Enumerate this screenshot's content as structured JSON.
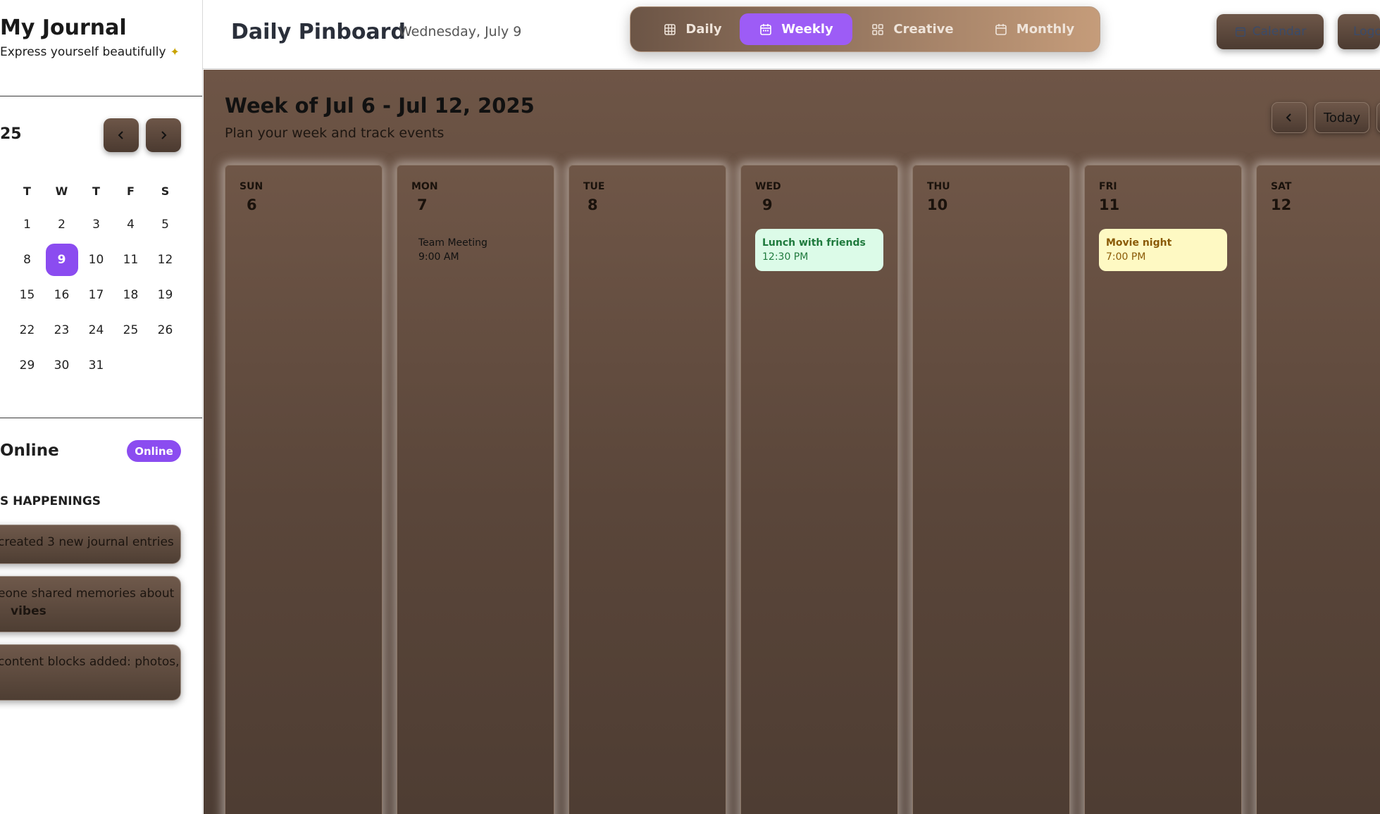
{
  "sidebar": {
    "title": "My Journal",
    "subtitle": "Express yourself beautifully",
    "calendar": {
      "title": "25",
      "weekdays": [
        "T",
        "W",
        "T",
        "F",
        "S"
      ],
      "weeks": [
        [
          "1",
          "2",
          "3",
          "4",
          "5"
        ],
        [
          "8",
          "9",
          "10",
          "11",
          "12"
        ],
        [
          "15",
          "16",
          "17",
          "18",
          "19"
        ],
        [
          "22",
          "23",
          "24",
          "25",
          "26"
        ],
        [
          "29",
          "30",
          "31",
          "",
          ""
        ]
      ],
      "selected_day": "9",
      "prev_icon": "chevron-left-icon",
      "next_icon": "chevron-right-icon"
    },
    "online": {
      "title": "Online",
      "badge": "Online"
    },
    "happenings": {
      "title": "S HAPPENINGS",
      "items": [
        {
          "text": "created 3 new journal entries",
          "bold": ""
        },
        {
          "text": "eone shared memories about",
          "bold": "vibes"
        },
        {
          "text": "content blocks added: photos,",
          "bold": ""
        }
      ]
    }
  },
  "header": {
    "title": "Daily Pinboard",
    "date": "Wednesday, July 9",
    "view_tabs": [
      {
        "label": "Daily",
        "icon": "grid-icon",
        "active": false
      },
      {
        "label": "Weekly",
        "icon": "calendar-icon",
        "active": true
      },
      {
        "label": "Creative",
        "icon": "layout-icon",
        "active": false
      },
      {
        "label": "Monthly",
        "icon": "calendar-icon",
        "active": false
      }
    ],
    "buttons": [
      {
        "label": "Calendar"
      },
      {
        "label": "Logo"
      }
    ]
  },
  "board": {
    "title": "Week of Jul 6 - Jul 12, 2025",
    "subtitle": "Plan your week and track events",
    "prev_icon": "chevron-left-icon",
    "today_label": "Today",
    "days": [
      {
        "name": "SUN",
        "num": "6",
        "event": null
      },
      {
        "name": "MON",
        "num": "7",
        "event": {
          "title": "Team Meeting",
          "time": "9:00 AM",
          "style": "plain"
        }
      },
      {
        "name": "TUE",
        "num": "8",
        "event": null
      },
      {
        "name": "WED",
        "num": "9",
        "event": {
          "title": "Lunch with friends",
          "time": "12:30 PM",
          "style": "green"
        }
      },
      {
        "name": "THU",
        "num": "10",
        "event": null
      },
      {
        "name": "FRI",
        "num": "11",
        "event": {
          "title": "Movie night",
          "time": "7:00 PM",
          "style": "yellow"
        }
      },
      {
        "name": "SAT",
        "num": "12",
        "event": null
      }
    ]
  },
  "colors": {
    "accent": "#8b4cf0",
    "board_brown": "#5e4a3e",
    "event_green_bg": "#dcfbe8",
    "event_yellow_bg": "#fef9c3"
  }
}
